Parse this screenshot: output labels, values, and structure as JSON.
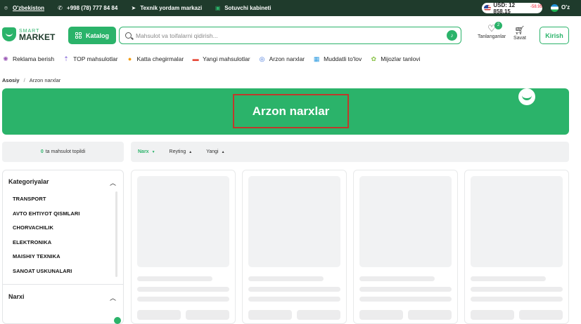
{
  "topbar": {
    "location": "O'zbekiston",
    "phone": "+998 (78) 777 84 84",
    "support": "Texnik yordam markazi",
    "seller": "Sotuvchi kabineti",
    "rate": "USD: 12 858.15",
    "rate_change": "-58.95",
    "lang": "O'z"
  },
  "logo": {
    "line1": "SMART",
    "line2": "MARKET"
  },
  "header": {
    "catalog": "Katalog",
    "search_placeholder": "Mahsulot va toifalarni qidirish...",
    "favorites": "Tanlanganlar",
    "favorites_count": "2",
    "cart": "Savat",
    "login": "Kirish"
  },
  "nav": [
    {
      "label": "Reklama berish",
      "icon": "megaphone-icon",
      "glyph": "✺",
      "color": "#9b59b6"
    },
    {
      "label": "TOP mahsulotlar",
      "icon": "top-arrow-icon",
      "glyph": "⇡",
      "color": "#7b5cd6"
    },
    {
      "label": "Katta chegirmalar",
      "icon": "discount-icon",
      "glyph": "●",
      "color": "#f39c12"
    },
    {
      "label": "Yangi mahsulotlar",
      "icon": "new-tag-icon",
      "glyph": "▬",
      "color": "#e74c3c"
    },
    {
      "label": "Arzon narxlar",
      "icon": "coin-icon",
      "glyph": "◎",
      "color": "#3b6fd8"
    },
    {
      "label": "Muddatli to'lov",
      "icon": "calendar-icon",
      "glyph": "▦",
      "color": "#2e9be0"
    },
    {
      "label": "Mijozlar tanlovi",
      "icon": "thumb-up-icon",
      "glyph": "✿",
      "color": "#8bc34a"
    }
  ],
  "breadcrumb": {
    "home": "Asosiy",
    "sep": "/",
    "current": "Arzon narxlar"
  },
  "banner": {
    "title": "Arzon narxlar"
  },
  "results": {
    "count": "0",
    "label": "ta mahsulot topildi"
  },
  "sort": [
    {
      "label": "Narx",
      "arrow": "▼",
      "active": true
    },
    {
      "label": "Reyting",
      "arrow": "▲",
      "active": false
    },
    {
      "label": "Yangi",
      "arrow": "▲",
      "active": false
    }
  ],
  "sidebar": {
    "categories_title": "Kategoriyalar",
    "categories": [
      "TRANSPORT",
      "AVTO EHTIYOT QISMLARI",
      "CHORVACHILIK",
      "ELEKTRONIKA",
      "MAISHIY TEXNIKA",
      "SANOAT USKUNALARI"
    ],
    "price_title": "Narxi"
  },
  "accent": "#2bb36a"
}
